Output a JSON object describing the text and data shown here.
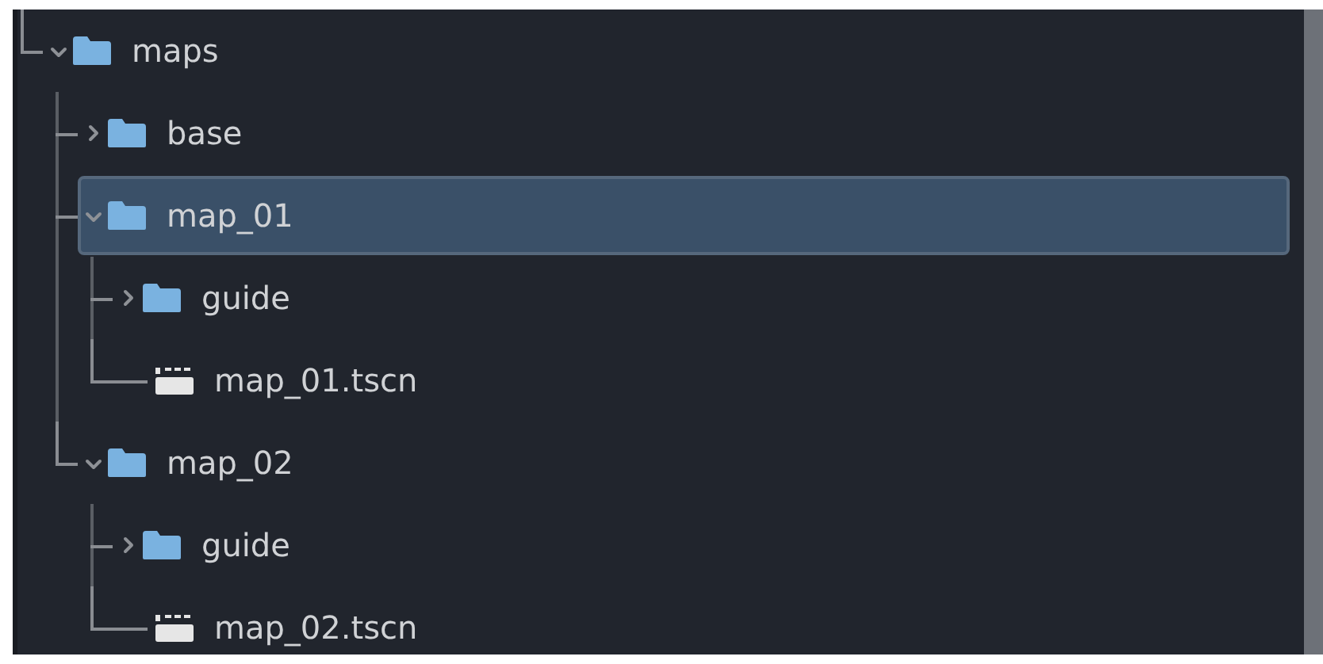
{
  "tree": {
    "items": [
      {
        "name": "maps",
        "kind": "folder",
        "expanded": true,
        "selected": false,
        "children": [
          {
            "name": "base",
            "kind": "folder",
            "expanded": false,
            "selected": false
          },
          {
            "name": "map_01",
            "kind": "folder",
            "expanded": true,
            "selected": true,
            "children": [
              {
                "name": "guide",
                "kind": "folder",
                "expanded": false,
                "selected": false
              },
              {
                "name": "map_01.tscn",
                "kind": "scene",
                "selected": false
              }
            ]
          },
          {
            "name": "map_02",
            "kind": "folder",
            "expanded": true,
            "selected": false,
            "children": [
              {
                "name": "guide",
                "kind": "folder",
                "expanded": false,
                "selected": false
              },
              {
                "name": "map_02.tscn",
                "kind": "scene",
                "selected": false
              }
            ]
          }
        ]
      }
    ]
  }
}
